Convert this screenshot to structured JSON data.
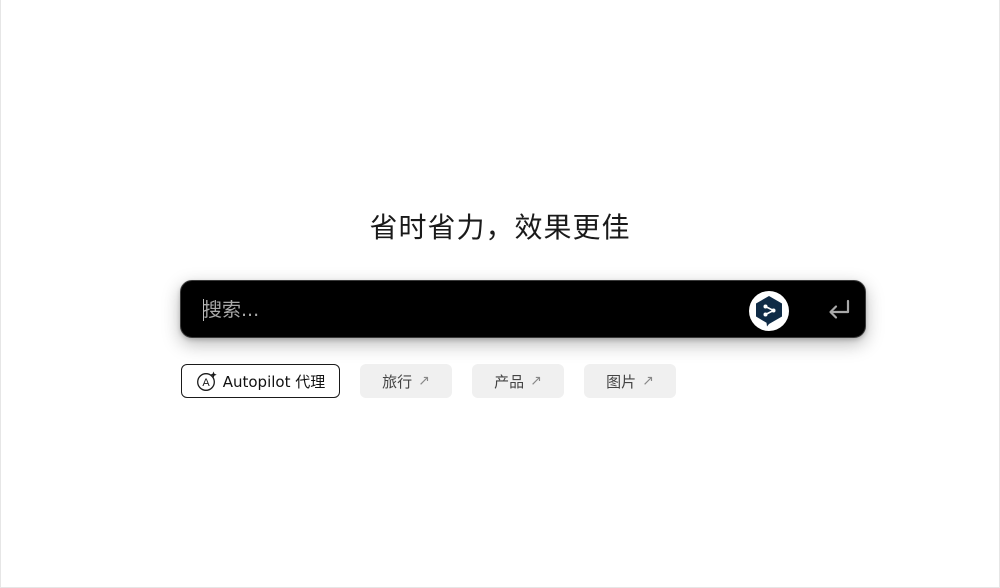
{
  "headline": "省时省力，效果更佳",
  "search": {
    "placeholder": "搜索...",
    "value": ""
  },
  "icons": {
    "deepl": "deepl-logo-icon",
    "enter": "enter-return-icon",
    "autopilot": "autopilot-sparkle-icon",
    "external": "arrow-up-right-icon"
  },
  "chips": {
    "autopilot": "Autopilot 代理",
    "travel": "旅行",
    "product": "产品",
    "image": "图片",
    "arrow": "↗"
  },
  "colors": {
    "search_bg": "#000000",
    "chip_bg": "#f0f0f0",
    "deepl_navy": "#0f2b46"
  }
}
